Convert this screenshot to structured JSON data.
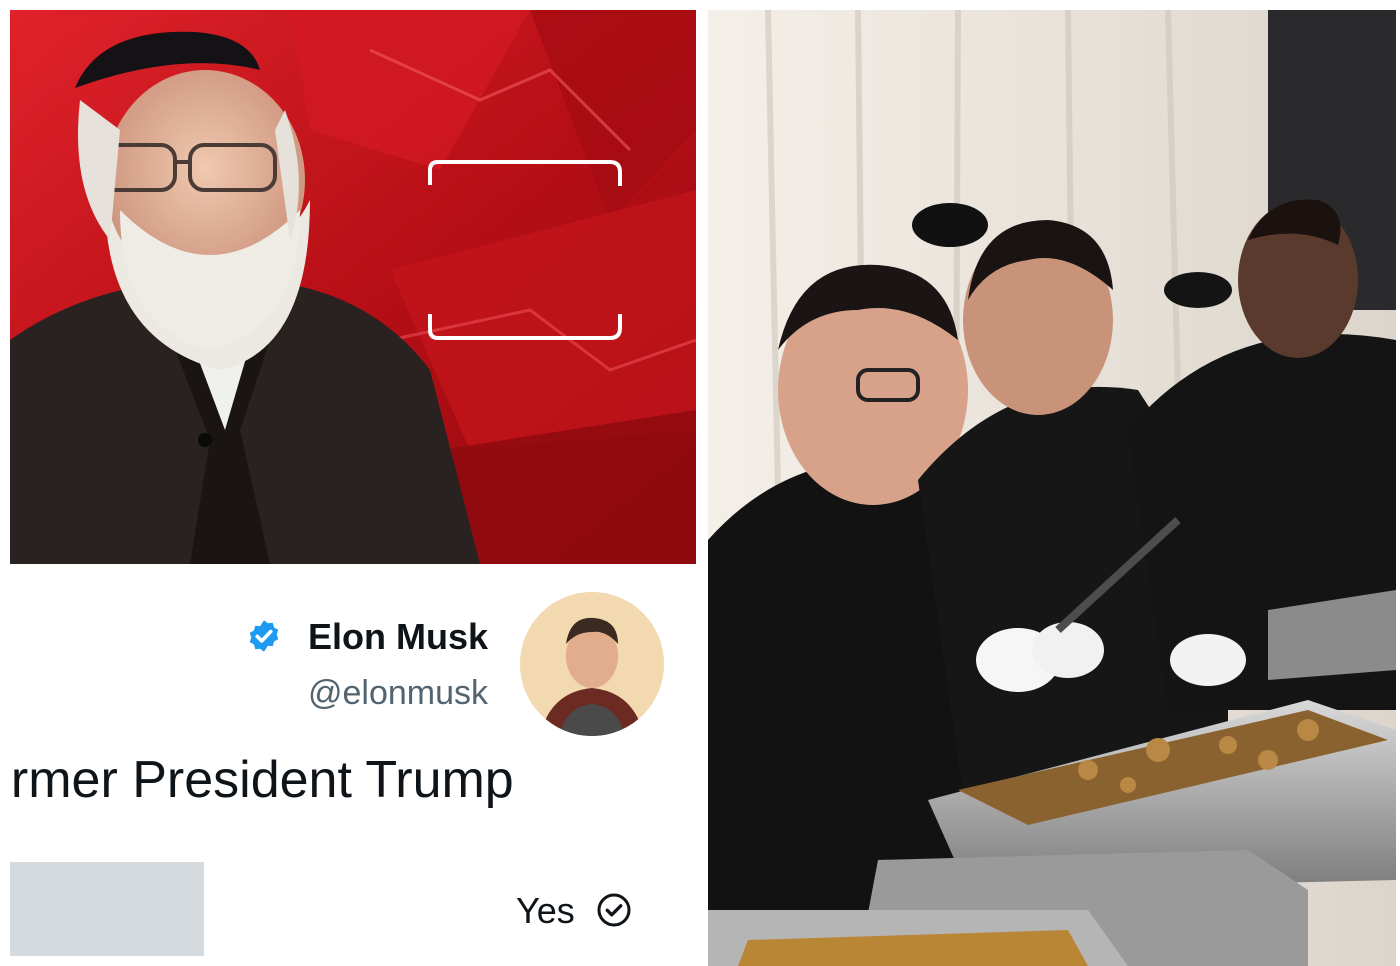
{
  "tweet": {
    "author_name": "Elon Musk",
    "author_handle": "@elonmusk",
    "text": "ormer President Trump",
    "poll_option": "Yes",
    "verified_icon": "verified-badge-icon",
    "check_icon": "check-circle-icon"
  },
  "colors": {
    "studio_red": "#c8141c",
    "verified_blue": "#1d9bf0",
    "handle_gray": "#536471",
    "redaction_gray": "#d5dadf"
  }
}
